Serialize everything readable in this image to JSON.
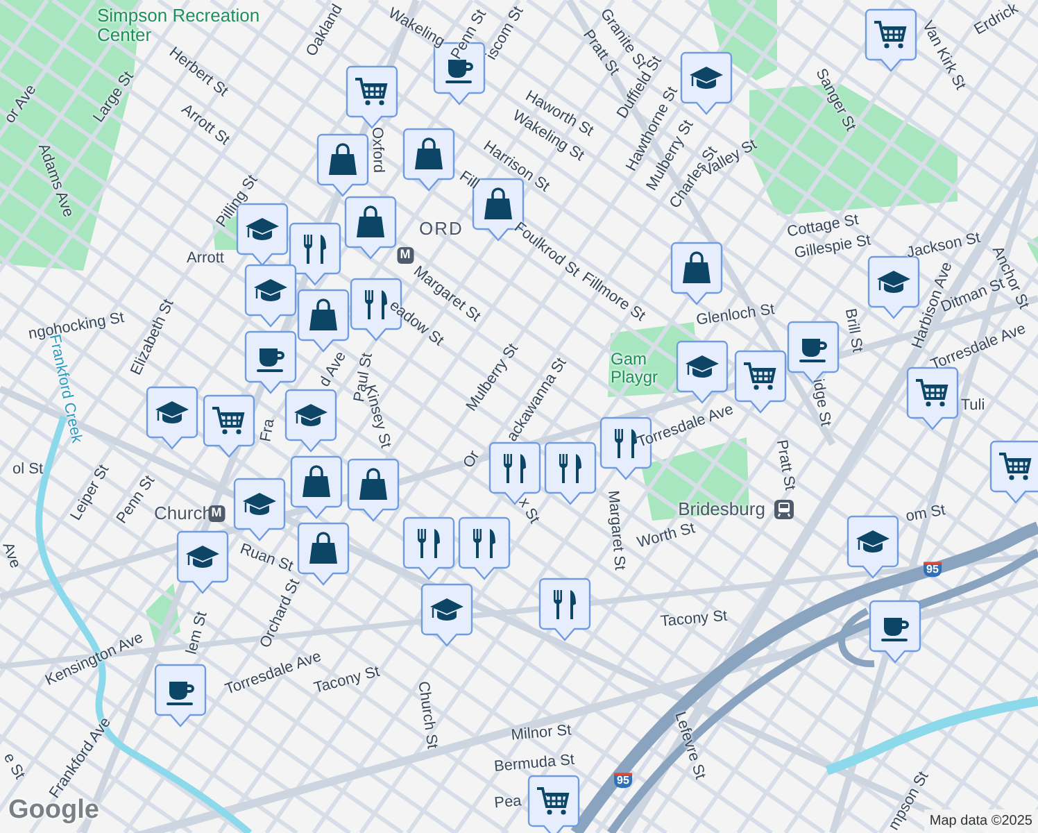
{
  "map": {
    "labels": [
      {
        "kind": "park",
        "text": "Simpson Recreation Center"
      },
      {
        "kind": "street",
        "text": "or Ave"
      },
      {
        "kind": "street",
        "text": "Oakland"
      },
      {
        "kind": "street",
        "text": "Wakeling"
      },
      {
        "kind": "street",
        "text": "Penn St"
      },
      {
        "kind": "street",
        "text": "iscom St"
      },
      {
        "kind": "street",
        "text": "Herbert St"
      },
      {
        "kind": "street",
        "text": "Large St"
      },
      {
        "kind": "street",
        "text": "Arrott St"
      },
      {
        "kind": "street",
        "text": "Adams Ave"
      },
      {
        "kind": "street",
        "text": "Oxford"
      },
      {
        "kind": "street",
        "text": "Harrison St"
      },
      {
        "kind": "street",
        "text": "Fill"
      },
      {
        "kind": "street",
        "text": "Pilling St"
      },
      {
        "kind": "district",
        "text": "ORD"
      },
      {
        "kind": "street",
        "text": "Foulkrod St"
      },
      {
        "kind": "street",
        "text": "Arrott"
      },
      {
        "kind": "street",
        "text": "Margaret St"
      },
      {
        "kind": "street",
        "text": "eadow St"
      },
      {
        "kind": "street",
        "text": "Mulberry St"
      },
      {
        "kind": "street",
        "text": "ngohocking St"
      },
      {
        "kind": "water",
        "text": "Frankford Creek"
      },
      {
        "kind": "street",
        "text": "Elizabeth St"
      },
      {
        "kind": "street",
        "text": "Paul St"
      },
      {
        "kind": "street",
        "text": "Kinsey St"
      },
      {
        "kind": "street",
        "text": "d Ave"
      },
      {
        "kind": "street",
        "text": "Fra"
      },
      {
        "kind": "street",
        "text": "ol St"
      },
      {
        "kind": "street",
        "text": "Leiper St"
      },
      {
        "kind": "street",
        "text": "Penn St"
      },
      {
        "kind": "station",
        "text": "Church"
      },
      {
        "kind": "badge",
        "text": "M"
      },
      {
        "kind": "badge",
        "text": "M"
      },
      {
        "kind": "street",
        "text": "Ruan St"
      },
      {
        "kind": "street",
        "text": "Orchard St"
      },
      {
        "kind": "street",
        "text": "lem St"
      },
      {
        "kind": "street",
        "text": "Kensington Ave"
      },
      {
        "kind": "street",
        "text": "Torresdale Ave"
      },
      {
        "kind": "street",
        "text": "Tacony St"
      },
      {
        "kind": "street",
        "text": "Church St"
      },
      {
        "kind": "street",
        "text": "Frankford Ave"
      },
      {
        "kind": "street",
        "text": "Ave"
      },
      {
        "kind": "street",
        "text": "e St"
      },
      {
        "kind": "street",
        "text": "Granite St"
      },
      {
        "kind": "street",
        "text": "Pratt St"
      },
      {
        "kind": "street",
        "text": "Duffield St"
      },
      {
        "kind": "street",
        "text": "Haworth St"
      },
      {
        "kind": "street",
        "text": "Wakeling St"
      },
      {
        "kind": "street",
        "text": "Hawthorne St"
      },
      {
        "kind": "street",
        "text": "Mulberry St"
      },
      {
        "kind": "street",
        "text": "Charles St"
      },
      {
        "kind": "street",
        "text": "Valley St"
      },
      {
        "kind": "street",
        "text": "Sanger St"
      },
      {
        "kind": "street",
        "text": "Van Kirk St"
      },
      {
        "kind": "street",
        "text": "Erdrick"
      },
      {
        "kind": "street",
        "text": "Fillmore St"
      },
      {
        "kind": "street",
        "text": "Cottage St"
      },
      {
        "kind": "street",
        "text": "Gillespie St"
      },
      {
        "kind": "street",
        "text": "Jackson St"
      },
      {
        "kind": "street",
        "text": "Anchor St"
      },
      {
        "kind": "street",
        "text": "Ditman St"
      },
      {
        "kind": "street",
        "text": "Harbison Ave"
      },
      {
        "kind": "street",
        "text": "Glenloch St"
      },
      {
        "kind": "street",
        "text": "Brill St"
      },
      {
        "kind": "street",
        "text": "idge St"
      },
      {
        "kind": "street",
        "text": "Torresdale Ave"
      },
      {
        "kind": "street",
        "text": "Tuli"
      },
      {
        "kind": "park",
        "text": "Gam Playgr"
      },
      {
        "kind": "street",
        "text": "ackawanna St"
      },
      {
        "kind": "street",
        "text": "Or"
      },
      {
        "kind": "street",
        "text": "x St"
      },
      {
        "kind": "street",
        "text": "Torresdale Ave"
      },
      {
        "kind": "street",
        "text": "Pratt St"
      },
      {
        "kind": "street",
        "text": "Margaret St"
      },
      {
        "kind": "station",
        "text": "Bridesburg"
      },
      {
        "kind": "street",
        "text": "Worth St"
      },
      {
        "kind": "street",
        "text": "om St"
      },
      {
        "kind": "street",
        "text": "Tacony St"
      },
      {
        "kind": "street",
        "text": "Milnor St"
      },
      {
        "kind": "street",
        "text": "Bermuda St"
      },
      {
        "kind": "street",
        "text": "Pea"
      },
      {
        "kind": "street",
        "text": "Lefevre St"
      },
      {
        "kind": "street",
        "text": "mpson St"
      },
      {
        "kind": "shield",
        "text": "95"
      },
      {
        "kind": "shield",
        "text": "95"
      }
    ],
    "markers": [
      {
        "kind": "cafe"
      },
      {
        "kind": "grocery"
      },
      {
        "kind": "shopping"
      },
      {
        "kind": "shopping"
      },
      {
        "kind": "shopping"
      },
      {
        "kind": "shopping"
      },
      {
        "kind": "school"
      },
      {
        "kind": "restaurant"
      },
      {
        "kind": "school"
      },
      {
        "kind": "shopping"
      },
      {
        "kind": "restaurant"
      },
      {
        "kind": "cafe"
      },
      {
        "kind": "grocery"
      },
      {
        "kind": "school"
      },
      {
        "kind": "school"
      },
      {
        "kind": "shopping"
      },
      {
        "kind": "shopping"
      },
      {
        "kind": "school"
      },
      {
        "kind": "shopping"
      },
      {
        "kind": "school"
      },
      {
        "kind": "restaurant"
      },
      {
        "kind": "restaurant"
      },
      {
        "kind": "school"
      },
      {
        "kind": "restaurant"
      },
      {
        "kind": "restaurant"
      },
      {
        "kind": "restaurant"
      },
      {
        "kind": "restaurant"
      },
      {
        "kind": "school"
      },
      {
        "kind": "grocery"
      },
      {
        "kind": "shopping"
      },
      {
        "kind": "school"
      },
      {
        "kind": "cafe"
      },
      {
        "kind": "grocery"
      },
      {
        "kind": "school"
      },
      {
        "kind": "grocery"
      },
      {
        "kind": "grocery"
      },
      {
        "kind": "school"
      },
      {
        "kind": "cafe"
      },
      {
        "kind": "cafe"
      },
      {
        "kind": "grocery"
      }
    ],
    "logo": "Google",
    "attribution": "Map data ©2025"
  }
}
